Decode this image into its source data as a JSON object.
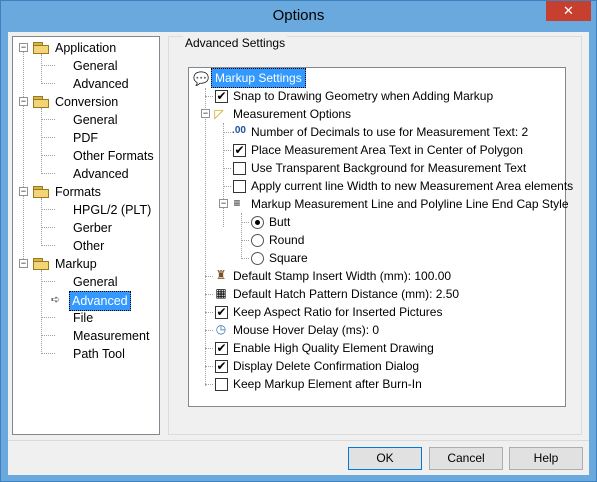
{
  "window": {
    "title": "Options",
    "close_label": "✕"
  },
  "tree": {
    "groups": [
      {
        "label": "Application",
        "children": [
          "General",
          "Advanced"
        ]
      },
      {
        "label": "Conversion",
        "children": [
          "General",
          "PDF",
          "Other Formats",
          "Advanced"
        ]
      },
      {
        "label": "Formats",
        "children": [
          "HPGL/2 (PLT)",
          "Gerber",
          "Other"
        ]
      },
      {
        "label": "Markup",
        "children": [
          "General",
          "Advanced",
          "File",
          "Measurement",
          "Path Tool"
        ]
      }
    ],
    "selected": "Markup > Advanced",
    "expander_symbol": "−"
  },
  "group": {
    "title": "Advanced Settings"
  },
  "settings": {
    "root": {
      "label": "Markup Settings",
      "icon": "markup-balloon-icon"
    },
    "snap": {
      "label": "Snap to Drawing Geometry when Adding Markup",
      "checked": true
    },
    "measure": {
      "label": "Measurement Options",
      "icon": "ruler-triangle-icon",
      "decimals": {
        "label": "Number of Decimals to use for Measurement Text: 2",
        "icon_text": ".00"
      },
      "area_center": {
        "label": "Place Measurement Area Text in Center of Polygon",
        "checked": true
      },
      "transparent": {
        "label": "Use Transparent Background for Measurement Text",
        "checked": false
      },
      "line_width": {
        "label": "Apply current line Width to new Measurement Area elements",
        "checked": false
      },
      "endcap": {
        "label": "Markup Measurement Line and Polyline Line End Cap Style",
        "options": [
          "Butt",
          "Round",
          "Square"
        ],
        "selected": "Butt"
      }
    },
    "stamp": {
      "label": "Default Stamp Insert Width (mm): 100.00",
      "icon": "stamp-icon"
    },
    "hatch": {
      "label": "Default Hatch Pattern Distance (mm): 2.50",
      "icon": "hatch-grid-icon"
    },
    "aspect": {
      "label": "Keep Aspect Ratio for Inserted Pictures",
      "checked": true
    },
    "hover": {
      "label": "Mouse Hover Delay (ms): 0",
      "icon": "clock-icon"
    },
    "hq": {
      "label": "Enable High Quality Element Drawing",
      "checked": true
    },
    "delete_confirm": {
      "label": "Display Delete Confirmation Dialog",
      "checked": true
    },
    "burn_in": {
      "label": "Keep Markup Element after Burn-In",
      "checked": false
    }
  },
  "buttons": {
    "ok": "OK",
    "cancel": "Cancel",
    "help": "Help"
  },
  "check_glyph": "✔",
  "colors": {
    "titlebar": "#6aa9dd",
    "selection": "#3399ff",
    "close": "#c7402f"
  }
}
